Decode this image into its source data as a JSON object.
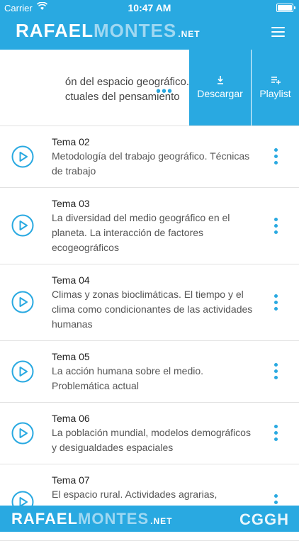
{
  "status": {
    "carrier": "Carrier",
    "time": "10:47 AM"
  },
  "header": {
    "logo_part1": "RAFAEL",
    "logo_part2": "MONTES",
    "logo_net": ".NET"
  },
  "current_item": {
    "line1": "ón del espacio geográfico.",
    "line2": "ctuales del pensamiento",
    "more": "•••"
  },
  "actions": {
    "download": "Descargar",
    "playlist": "Playlist"
  },
  "items": [
    {
      "title": "Tema 02",
      "desc": "Metodología del trabajo geográfico. Técnicas de trabajo"
    },
    {
      "title": "Tema 03",
      "desc": "La diversidad del medio geográfico en el planeta. La interacción de factores ecogeográficos"
    },
    {
      "title": "Tema 04",
      "desc": "Climas y zonas bioclimáticas. El tiempo y el clima como condicionantes de las actividades humanas"
    },
    {
      "title": "Tema 05",
      "desc": "La acción humana sobre el medio. Problemática actual"
    },
    {
      "title": "Tema 06",
      "desc": "La población mundial, modelos demográficos y desigualdades espaciales"
    },
    {
      "title": "Tema 07",
      "desc": "El espacio rural. Actividades agrarias,"
    }
  ],
  "footer": {
    "logo_part1": "RAFAEL",
    "logo_part2": "MONTES",
    "logo_net": ".NET",
    "org": "CGGH"
  },
  "colors": {
    "accent": "#29a9e1"
  }
}
